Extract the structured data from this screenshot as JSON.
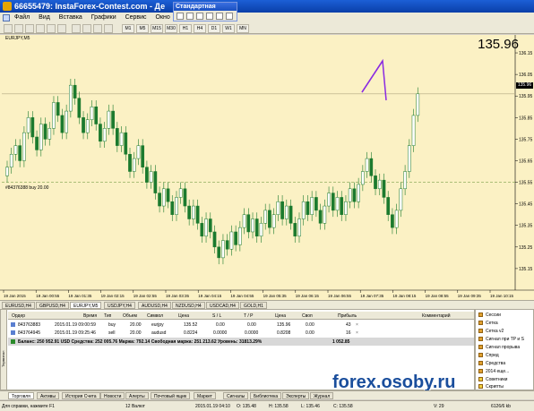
{
  "app": {
    "title": "66655479: InstaForex-Contest.com - Де",
    "menu": [
      "Файл",
      "Вид",
      "Вставка",
      "Графики",
      "Сервис",
      "Окно"
    ]
  },
  "toolbar": {
    "timeframes": [
      "M1",
      "M5",
      "M15",
      "M30",
      "H1",
      "H4",
      "D1",
      "W1",
      "MN"
    ]
  },
  "popup": {
    "title": "Стандартная"
  },
  "chart": {
    "symbol_label": "EURJPY,M5",
    "current_price": "135.96",
    "price_tag": "135.96",
    "order_label": "#84376388 buy 20.00",
    "bid_color": "#000000",
    "arrow_color": "#8a2be2",
    "candle_color": "#1b7a2e",
    "grid_color": "#d8c887",
    "order_line_color": "#7fa04a"
  },
  "chart_data": {
    "type": "candlestick",
    "symbol": "EURJPY",
    "timeframe": "M5",
    "ylim": [
      135.05,
      136.2
    ],
    "yticks": [
      136.15,
      136.05,
      135.95,
      135.85,
      135.75,
      135.65,
      135.55,
      135.45,
      135.35,
      135.25,
      135.15
    ],
    "xticks": [
      "19 Jan 2015",
      "19 Jan 00:55",
      "19 Jan 01:35",
      "19 Jan 02:15",
      "19 Jan 02:55",
      "19 Jan 03:35",
      "19 Jan 04:15",
      "19 Jan 04:55",
      "19 Jan 05:35",
      "19 Jan 06:15",
      "19 Jan 06:55",
      "19 Jan 07:35",
      "19 Jan 08:15",
      "19 Jan 08:55",
      "19 Jan 09:35",
      "19 Jan 10:15"
    ],
    "last_price": 135.96,
    "order_line_price": 135.55,
    "close": [
      135.62,
      135.68,
      135.72,
      135.65,
      135.78,
      135.85,
      135.76,
      135.7,
      135.82,
      135.75,
      135.8,
      135.92,
      135.86,
      135.78,
      135.88,
      136.0,
      135.94,
      135.85,
      135.78,
      135.84,
      135.9,
      135.82,
      135.74,
      135.8,
      135.88,
      135.8,
      135.72,
      135.78,
      135.68,
      135.6,
      135.66,
      135.72,
      135.62,
      135.55,
      135.6,
      135.5,
      135.44,
      135.52,
      135.46,
      135.4,
      135.48,
      135.52,
      135.44,
      135.38,
      135.44,
      135.36,
      135.3,
      135.38,
      135.32,
      135.25,
      135.2,
      135.28,
      135.24,
      135.32,
      135.26,
      135.34,
      135.4,
      135.32,
      135.38,
      135.3,
      135.36,
      135.42,
      135.34,
      135.4,
      135.46,
      135.38,
      135.44,
      135.36,
      135.3,
      135.38,
      135.46,
      135.4,
      135.48,
      135.42,
      135.36,
      135.44,
      135.5,
      135.42,
      135.48,
      135.4,
      135.46,
      135.52,
      135.46,
      135.54,
      135.6,
      135.66,
      135.58,
      135.52,
      135.56,
      135.48,
      135.4,
      135.34,
      135.42,
      135.52,
      135.6,
      135.72,
      135.86,
      135.96
    ]
  },
  "symbol_tabs": [
    "EURUSD,H4",
    "GBPUSD,H4",
    "EURJPY,M5",
    "USDJPY,H4",
    "AUDUSD,H4",
    "NZDUSD,H4",
    "USDCAD,H4",
    "GOLD,H1"
  ],
  "terminal": {
    "headers": [
      "Ордер",
      "Время",
      "Тип",
      "Объем",
      "Символ",
      "Цена",
      "S / L",
      "T / P",
      "Цена",
      "Своп",
      "Прибыль",
      "Комментарий"
    ],
    "rows": [
      [
        "843763883",
        "2015.01.19 09:00:59",
        "buy",
        "20.00",
        "eurjpy",
        "135.52",
        "0.00",
        "0.00",
        "135.96",
        "0.00",
        "43"
      ],
      [
        "843764945",
        "2015.01.19 09:25:46",
        "sell",
        "20.00",
        "audusd",
        "0.8224",
        "0.0000",
        "0.0000",
        "0.8208",
        "0.00",
        "16"
      ]
    ],
    "balance": "Баланс: 250 952.91 USD  Средства: 252 005.76  Маржа: 792.14  Свободная маржа: 251 213.62  Уровень: 31813.29%",
    "balance_total": "1 052.85",
    "side_label": "Терминал"
  },
  "navigator": {
    "items": [
      "Сессии",
      "Сетка",
      "Сетка v2",
      "Сигнал при TP и S",
      "Сигнал прорыва",
      "Спред",
      "Средства",
      "2014 еще..."
    ],
    "footer": [
      "Советники",
      "Скрипты"
    ]
  },
  "terminal_tabs": [
    "Торговля",
    "Активы",
    "История Счета",
    "Новости",
    "Алерты",
    "Почтовый ящик",
    "Маркет",
    "Сигналы",
    "Библиотека",
    "Эксперты",
    "Журнал"
  ],
  "status": {
    "help": "Для справки, нажмите F1",
    "profile": "12 Валют",
    "datetime": "2015.01.19 04:10",
    "open": "O: 135.48",
    "high": "H: 135.58",
    "low": "L: 135.46",
    "close": "C: 135.58",
    "v": "V: 29",
    "traffic": "6126/6 kb"
  },
  "watermark": "forex.osoby.ru"
}
